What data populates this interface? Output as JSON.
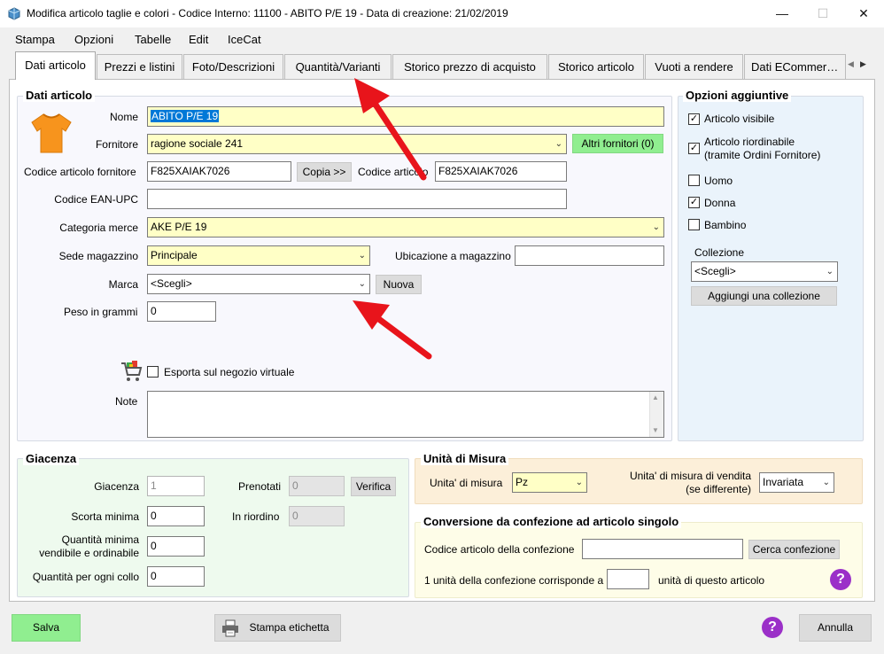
{
  "window": {
    "title": "Modifica articolo taglie e colori - Codice Interno: 11100 - ABITO P/E 19 - Data di creazione: 21/02/2019",
    "minimize": "—",
    "maximize": "☐",
    "close": "✕"
  },
  "menu": [
    "Stampa",
    "Opzioni",
    "Tabelle",
    "Edit",
    "IceCat"
  ],
  "tabs": [
    "Dati articolo",
    "Prezzi e listini",
    "Foto/Descrizioni",
    "Quantità/Varianti",
    "Storico prezzo di acquisto",
    "Storico articolo",
    "Vuoti a rendere",
    "Dati  ECommer…"
  ],
  "dati_articolo": {
    "title": "Dati articolo",
    "nome_label": "Nome",
    "nome_value": "ABITO P/E 19",
    "fornitore_label": "Fornitore",
    "fornitore_value": "ragione sociale 241",
    "altri_fornitori": "Altri fornitori (0)",
    "codice_fornitore_label": "Codice articolo fornitore",
    "codice_fornitore_value": "F825XAIAK7026",
    "copia_button": "Copia >>",
    "codice_articolo_label": "Codice articolo",
    "codice_articolo_value": "F825XAIAK7026",
    "ean_label": "Codice EAN-UPC",
    "ean_value": "",
    "categoria_label": "Categoria merce",
    "categoria_value": "AKE P/E 19",
    "sede_label": "Sede magazzino",
    "sede_value": "Principale",
    "ubicazione_label": "Ubicazione a magazzino",
    "ubicazione_value": "",
    "marca_label": "Marca",
    "marca_value": "<Scegli>",
    "nuova_button": "Nuova",
    "peso_label": "Peso in grammi",
    "peso_value": "0",
    "esporta_label": "Esporta sul negozio virtuale",
    "note_label": "Note",
    "note_value": ""
  },
  "opzioni": {
    "title": "Opzioni aggiuntive",
    "articolo_visibile": "Articolo visibile",
    "articolo_riordinabile": "Articolo riordinabile",
    "articolo_riordinabile_sub": "(tramite Ordini Fornitore)",
    "uomo": "Uomo",
    "donna": "Donna",
    "bambino": "Bambino",
    "collezione_label": "Collezione",
    "collezione_value": "<Scegli>",
    "aggiungi_collezione": "Aggiungi una collezione"
  },
  "giacenza": {
    "title": "Giacenza",
    "giacenza_label": "Giacenza",
    "giacenza_value": "1",
    "prenotati_label": "Prenotati",
    "prenotati_value": "0",
    "verifica_button": "Verifica",
    "scorta_label": "Scorta minima",
    "scorta_value": "0",
    "in_riordino_label": "In riordino",
    "in_riordino_value": "0",
    "qmin_label_1": "Quantità minima",
    "qmin_label_2": "vendibile e ordinabile",
    "qmin_value": "0",
    "qcollo_label": "Quantità per ogni collo",
    "qcollo_value": "0"
  },
  "unita": {
    "title": "Unità di Misura",
    "um_label": "Unita' di misura",
    "um_value": "Pz",
    "um_vendita_label_1": "Unita' di misura di vendita",
    "um_vendita_label_2": "(se differente)",
    "um_vendita_value": "Invariata"
  },
  "conversione": {
    "title": "Conversione da confezione ad articolo singolo",
    "codice_confezione_label": "Codice articolo della confezione",
    "codice_confezione_value": "",
    "cerca_button": "Cerca confezione",
    "unita_label": "1 unità della confezione corrisponde a",
    "unita_value": "",
    "unita_suffix": "unità di questo articolo"
  },
  "footer": {
    "salva": "Salva",
    "stampa_etichetta": "Stampa etichetta",
    "annulla": "Annulla"
  },
  "help_glyph": "?",
  "colors": {
    "highlight_yellow": "#ffffc6",
    "green_button": "#90ee90",
    "options_panel_bg": "#eaf3fb",
    "giacenza_bg": "#eefaee",
    "unita_bg": "#fcefd9",
    "conversione_bg": "#fefde8",
    "annotation_arrow": "#e8141b",
    "help_purple": "#9b30c8"
  }
}
